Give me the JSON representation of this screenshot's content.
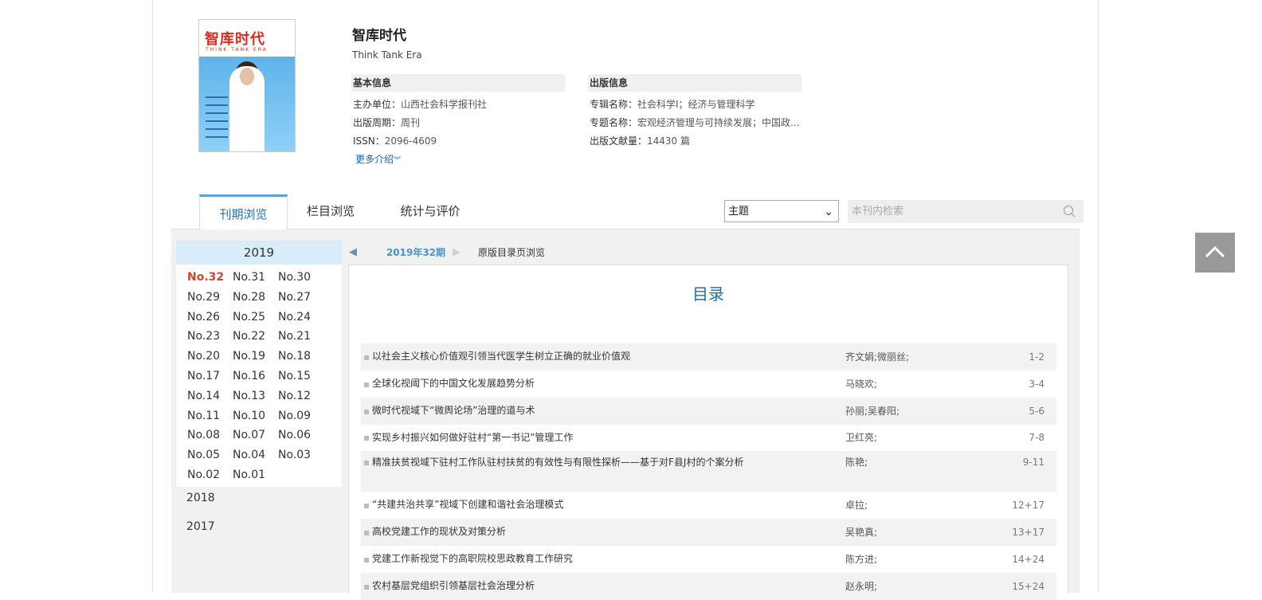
{
  "journal": {
    "cover_title": "智库时代",
    "cover_subtitle": "THINK TANK ERA",
    "title": "智库时代",
    "english": "Think Tank Era"
  },
  "basic": {
    "header": "基本信息",
    "rows": [
      {
        "label": "主办单位：",
        "value": "山西社会科学报刊社"
      },
      {
        "label": "出版周期：",
        "value": "周刊"
      },
      {
        "label": "ISSN：",
        "value": "2096-4609"
      }
    ]
  },
  "publish": {
    "header": "出版信息",
    "rows": [
      {
        "label": "专辑名称：",
        "value": "社会科学Ⅰ；经济与管理科学"
      },
      {
        "label": "专题名称：",
        "value": "宏观经济管理与可持续发展；中国政..."
      },
      {
        "label": "出版文献量：",
        "value": "14430 篇"
      }
    ]
  },
  "more_link": "更多介绍",
  "tabs": [
    "刊期浏览",
    "栏目浏览",
    "统计与评价"
  ],
  "search": {
    "select_value": "主题",
    "placeholder": "本刊内检索"
  },
  "years": {
    "current": "2019",
    "issues": [
      [
        "No.32",
        "No.31",
        "No.30"
      ],
      [
        "No.29",
        "No.28",
        "No.27"
      ],
      [
        "No.26",
        "No.25",
        "No.24"
      ],
      [
        "No.23",
        "No.22",
        "No.21"
      ],
      [
        "No.20",
        "No.19",
        "No.18"
      ],
      [
        "No.17",
        "No.16",
        "No.15"
      ],
      [
        "No.14",
        "No.13",
        "No.12"
      ],
      [
        "No.11",
        "No.10",
        "No.09"
      ],
      [
        "No.08",
        "No.07",
        "No.06"
      ],
      [
        "No.05",
        "No.04",
        "No.03"
      ],
      [
        "No.02",
        "No.01",
        ""
      ]
    ],
    "other": [
      "2018",
      "2017"
    ]
  },
  "issue_bar": {
    "current": "2019年32期",
    "original": "原版目录页浏览"
  },
  "toc": {
    "title": "目录",
    "items": [
      {
        "title": "以社会主义核心价值观引领当代医学生树立正确的就业价值观",
        "authors": "齐文娟;微丽丝;",
        "pages": "1-2"
      },
      {
        "title": "全球化视阈下的中国文化发展趋势分析",
        "authors": "马晓欢;",
        "pages": "3-4"
      },
      {
        "title": "微时代视域下“微舆论场”治理的道与术",
        "authors": "孙丽;吴春阳;",
        "pages": "5-6"
      },
      {
        "title": "实现乡村振兴如何做好驻村“第一书记”管理工作",
        "authors": "卫红亮;",
        "pages": "7-8"
      },
      {
        "title": "精准扶贫视域下驻村工作队驻村扶贫的有效性与有限性探析——基于对F县J村的个案分析",
        "authors": "陈艳;",
        "pages": "9-11"
      },
      {
        "title": "“共建共治共享”视域下创建和谐社会治理模式",
        "authors": "卓拉;",
        "pages": "12+17"
      },
      {
        "title": "高校党建工作的现状及对策分析",
        "authors": "吴艳真;",
        "pages": "13+17"
      },
      {
        "title": "党建工作新视觉下的高职院校思政教育工作研究",
        "authors": "陈方进;",
        "pages": "14+24"
      },
      {
        "title": "农村基层党组织引领基层社会治理分析",
        "authors": "赵永明;",
        "pages": "15+24"
      }
    ]
  }
}
